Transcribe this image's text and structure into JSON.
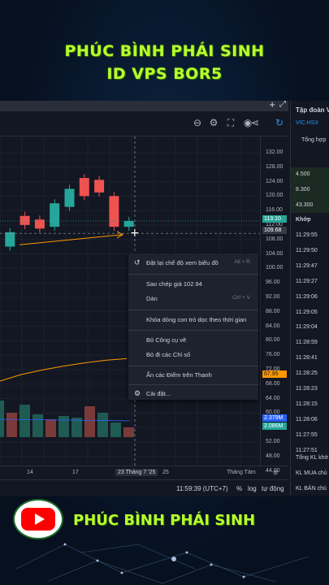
{
  "banner": {
    "line1": "PHÚC BÌNH PHÁI SINH",
    "line2": "ID VPS BOR5"
  },
  "footer": {
    "name": "PHÚC BÌNH PHÁI SINH"
  },
  "colors": {
    "up": "#26a69a",
    "down": "#ef5350",
    "green_bright": "#4caf50"
  },
  "y_axis": {
    "ticks": [
      "132.00",
      "128.00",
      "124.00",
      "120.00",
      "116.00",
      "112.00",
      "108.00",
      "104.00",
      "100.00",
      "96.00",
      "92.00",
      "88.00",
      "84.00",
      "80.00",
      "76.00",
      "72.00",
      "68.00",
      "64.00",
      "60.00",
      "56.00",
      "52.00",
      "48.00",
      "44.00"
    ],
    "last_price": "113.10",
    "crosshair_price": "109.68",
    "indicator_value": "67.95",
    "volume_a": "2.379M",
    "volume_b": "2.086M"
  },
  "x_axis": {
    "ticks": [
      "14",
      "17",
      "23 Tháng 7 '25",
      "25",
      "Tháng Tám"
    ]
  },
  "status": {
    "time": "11:59:39 (UTC+7)",
    "percent": "%",
    "log": "log",
    "auto": "tự động"
  },
  "context_menu": {
    "reset": {
      "label": "Đặt lại chế độ xem biểu đồ",
      "shortcut": "Alt + R"
    },
    "copy_price": {
      "label": "Sao chép giá 102.94"
    },
    "paste": {
      "label": "Dán",
      "shortcut": "Ctrl + V"
    },
    "lock_cursor": {
      "label": "Khóa dòng con trỏ dọc theo thời gian"
    },
    "remove_drawings": {
      "label": "Bỏ Công cụ vẽ"
    },
    "remove_indicators": {
      "label": "Bỏ đi các Chỉ số"
    },
    "hide_marks": {
      "label": "Ẩn các Điểm trên Thanh"
    },
    "settings": {
      "label": "Cài đặt..."
    }
  },
  "panel": {
    "title": "Tập đoàn V",
    "symbol": "VIC:HSX",
    "summary": "Tổng hợp",
    "levels": [
      "4.500",
      "8.300",
      "43.300"
    ],
    "match_header": "Khớp",
    "times": [
      "11:29:55",
      "11:29:50",
      "11:29:47",
      "11:29:27",
      "11:29:06",
      "11:29:05",
      "11:29:04",
      "11:28:59",
      "11:28:41",
      "11:28:25",
      "11:28:23",
      "11:28:15",
      "11:28:06",
      "11:27:55",
      "11:27:51"
    ],
    "total_label": "Tổng KL khớ",
    "buy_label": "KL MUA chủ",
    "sell_label": "KL BÁN chủ"
  },
  "chart_data": {
    "type": "candlestick",
    "y_range": [
      44,
      132
    ],
    "candles": [
      {
        "o": 98.5,
        "c": 104.5,
        "up": true
      },
      {
        "o": 106,
        "c": 110,
        "up": true
      },
      {
        "o": 114.5,
        "c": 112,
        "up": false
      },
      {
        "o": 111,
        "c": 113.5,
        "up": false
      },
      {
        "o": 111.5,
        "c": 118,
        "up": true
      },
      {
        "o": 117,
        "c": 122,
        "up": true
      },
      {
        "o": 125,
        "c": 120,
        "up": false
      },
      {
        "o": 121,
        "c": 124.5,
        "up": false
      },
      {
        "o": 120,
        "c": 111.5,
        "up": false
      },
      {
        "o": 111.5,
        "c": 113.1,
        "up": true
      }
    ],
    "indicator_line": [
      64.5,
      65.5,
      66.2,
      66.8,
      67.3,
      67.7,
      67.95
    ]
  }
}
